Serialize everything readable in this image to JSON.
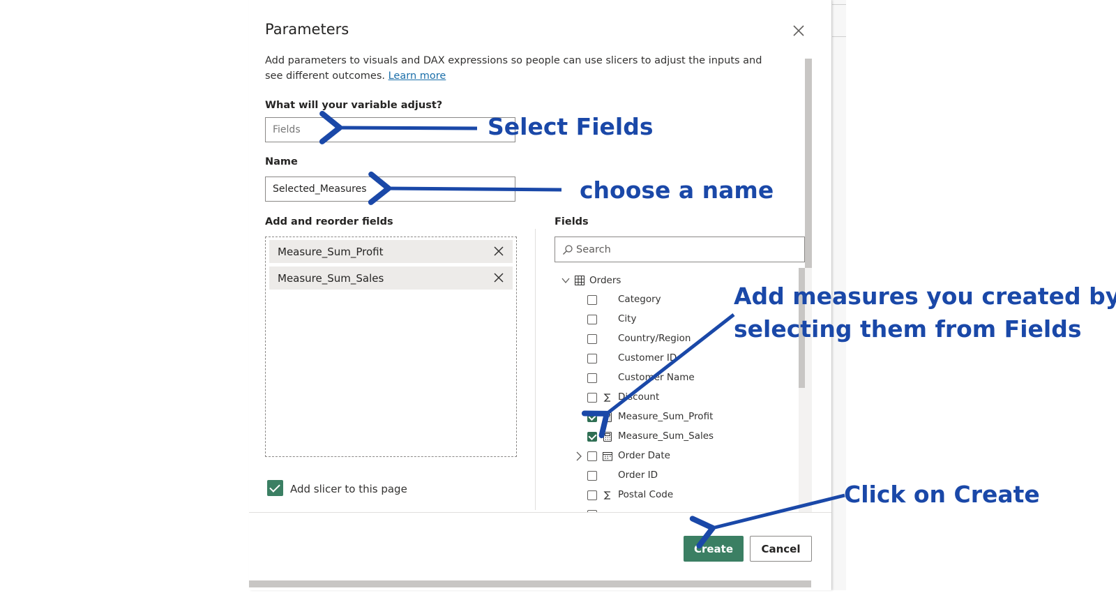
{
  "dialog": {
    "title": "Parameters",
    "description": "Add parameters to visuals and DAX expressions so people can use slicers to adjust the inputs and see different outcomes.",
    "learn_more": "Learn more",
    "variable_label": "What will your variable adjust?",
    "variable_value": "Fields",
    "name_label": "Name",
    "name_value": "Selected_Measures",
    "reorder_label": "Add and reorder fields",
    "selected_fields": [
      {
        "label": "Measure_Sum_Profit"
      },
      {
        "label": "Measure_Sum_Sales"
      }
    ],
    "fields_label": "Fields",
    "search_placeholder": "Search",
    "table_name": "Orders",
    "fields": [
      {
        "label": "Category",
        "checked": false,
        "icon": "none"
      },
      {
        "label": "City",
        "checked": false,
        "icon": "none"
      },
      {
        "label": "Country/Region",
        "checked": false,
        "icon": "none"
      },
      {
        "label": "Customer ID",
        "checked": false,
        "icon": "none"
      },
      {
        "label": "Customer Name",
        "checked": false,
        "icon": "none"
      },
      {
        "label": "Discount",
        "checked": false,
        "icon": "sigma-icon"
      },
      {
        "label": "Measure_Sum_Profit",
        "checked": true,
        "icon": "calculator-icon"
      },
      {
        "label": "Measure_Sum_Sales",
        "checked": true,
        "icon": "calculator-icon"
      },
      {
        "label": "Order Date",
        "checked": false,
        "icon": "calendar-icon",
        "expandable": true
      },
      {
        "label": "Order ID",
        "checked": false,
        "icon": "none"
      },
      {
        "label": "Postal Code",
        "checked": false,
        "icon": "sigma-icon"
      }
    ],
    "slicer_label": "Add slicer to this page",
    "slicer_checked": true,
    "create_label": "Create",
    "cancel_label": "Cancel",
    "accent_color": "#3b7f63"
  },
  "annotations": {
    "select_fields": "Select Fields",
    "choose_name": "choose a name",
    "add_measures_line1": "Add measures you created by",
    "add_measures_line2": "selecting them from Fields",
    "click_create": "Click on Create",
    "color": "#1a48a8"
  }
}
